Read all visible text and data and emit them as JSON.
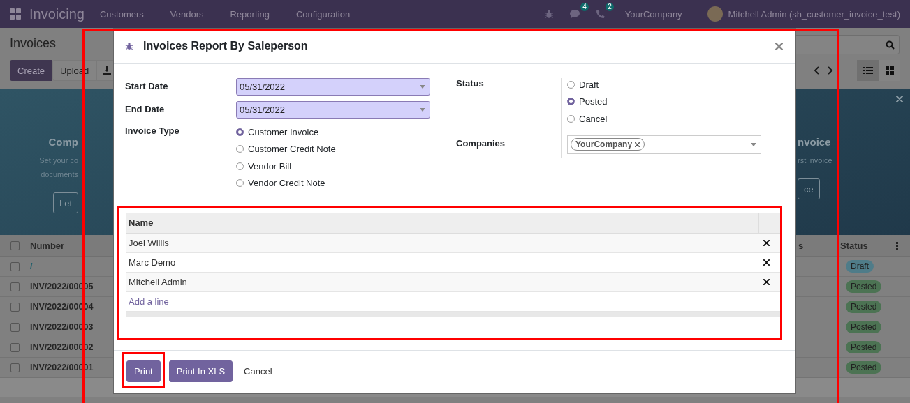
{
  "navbar": {
    "app": "Invoicing",
    "menu": [
      "Customers",
      "Vendors",
      "Reporting",
      "Configuration"
    ],
    "chat_count": "4",
    "activity_count": "2",
    "company": "YourCompany",
    "user": "Mitchell Admin (sh_customer_invoice_test)"
  },
  "control_panel": {
    "title": "Invoices",
    "buttons": [
      {
        "label": "Create",
        "kind": "primary"
      },
      {
        "label": "Upload",
        "kind": "secondary"
      }
    ]
  },
  "banner": {
    "left_title": "Comp",
    "left_lines": [
      "Set your co",
      "documents"
    ],
    "left_button": "Let",
    "right_title": "nvoice",
    "right_lines": [
      "rst invoice"
    ],
    "right_button": "ce"
  },
  "list": {
    "columns": [
      "Number",
      "s",
      "Status"
    ],
    "all_checked": false,
    "rows": [
      {
        "number": "/",
        "status": "Draft",
        "color": "#4f7c89",
        "checked": false
      },
      {
        "number": "INV/2022/00005",
        "status": "Posted",
        "color": "#4c7353",
        "checked": false
      },
      {
        "number": "INV/2022/00004",
        "status": "Posted",
        "color": "#4c7353",
        "checked": false
      },
      {
        "number": "INV/2022/00003",
        "status": "Posted",
        "color": "#4c7353",
        "checked": false
      },
      {
        "number": "INV/2022/00002",
        "status": "Posted",
        "color": "#4c7353",
        "checked": false
      },
      {
        "number": "INV/2022/00001",
        "status": "Posted",
        "color": "#4c7353",
        "checked": false
      }
    ]
  },
  "dialog": {
    "title": "Invoices Report By Saleperson",
    "start_date": {
      "label": "Start Date",
      "value": "05/31/2022"
    },
    "end_date": {
      "label": "End Date",
      "value": "05/31/2022"
    },
    "invoice_type": {
      "label": "Invoice Type",
      "options": [
        {
          "label": "Customer Invoice",
          "selected": true
        },
        {
          "label": "Customer Credit Note",
          "selected": false
        },
        {
          "label": "Vendor Bill",
          "selected": false
        },
        {
          "label": "Vendor Credit Note",
          "selected": false
        }
      ]
    },
    "status": {
      "label": "Status",
      "options": [
        {
          "label": "Draft",
          "selected": false
        },
        {
          "label": "Posted",
          "selected": true
        },
        {
          "label": "Cancel",
          "selected": false
        }
      ]
    },
    "companies": {
      "label": "Companies",
      "tags": [
        "YourCompany"
      ]
    },
    "salespersons": {
      "column": "Name",
      "rows": [
        "Joel Willis",
        "Marc Demo",
        "Mitchell Admin"
      ],
      "add_line": "Add a line"
    },
    "buttons": [
      {
        "label": "Print",
        "kind": "primary"
      },
      {
        "label": "Print In XLS",
        "kind": "primary"
      },
      {
        "label": "Cancel",
        "kind": "link"
      }
    ]
  }
}
